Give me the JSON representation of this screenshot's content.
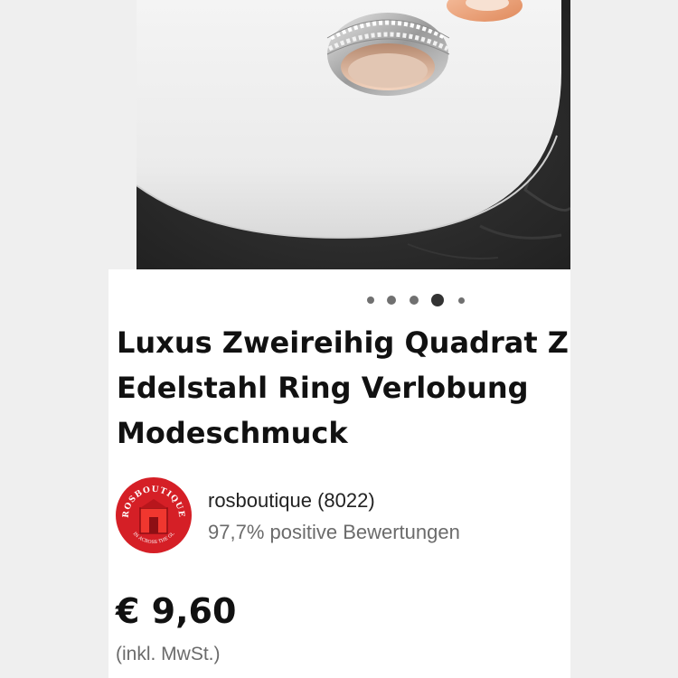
{
  "gallery": {
    "image_alt": "",
    "total_images": 5,
    "active_index": 3
  },
  "listing": {
    "title_lines": [
      "Luxus Zweireihig Quadrat Zirkonia",
      "Edelstahl Ring Verlobung",
      "Modeschmuck"
    ]
  },
  "seller": {
    "logo_text_top": "ROSBOUTIQUE",
    "logo_text_bottom": "IN ACROSS THE GL",
    "name": "rosboutique (8022)",
    "feedback": "97,7% positive Bewertungen"
  },
  "pricing": {
    "price": "€ 9,60",
    "tax_note": "(inkl. MwSt.)"
  },
  "colors": {
    "logo_red": "#d51f26",
    "title_text": "#111111",
    "secondary_text": "#6b6b6b",
    "dot_active": "#333333",
    "dot_inactive": "#707070"
  }
}
